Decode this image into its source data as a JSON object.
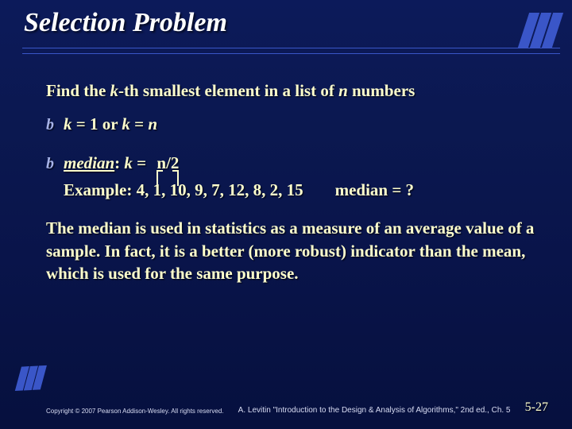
{
  "title": "Selection Problem",
  "lead_pre": "Find the ",
  "lead_k": "k",
  "lead_post1": "-th smallest element in a list of ",
  "lead_n": "n",
  "lead_post2": " numbers",
  "bullet1_k1": "k",
  "bullet1_eq1": " = 1 or ",
  "bullet1_k2": "k",
  "bullet1_eq2": " = ",
  "bullet1_n": "n",
  "bullet2_median": "median",
  "bullet2_colon": ": ",
  "bullet2_k": "k",
  "bullet2_eq": " = ",
  "bullet2_expr": "n/2",
  "example_label": "Example: ",
  "example_values": "4,  1,  10,  9,  7,  12,  8,  2,  15",
  "example_q": "median = ?",
  "paragraph": "The median is used in statistics as a measure of an average value of a sample.  In fact, it is a better (more robust) indicator than the mean, which is used for the same purpose.",
  "footer_left": "Copyright © 2007 Pearson Addison-Wesley. All rights reserved.",
  "footer_mid": "A. Levitin \"Introduction to the Design & Analysis of Algorithms,\" 2nd ed., Ch. 5",
  "footer_right": "5-27"
}
